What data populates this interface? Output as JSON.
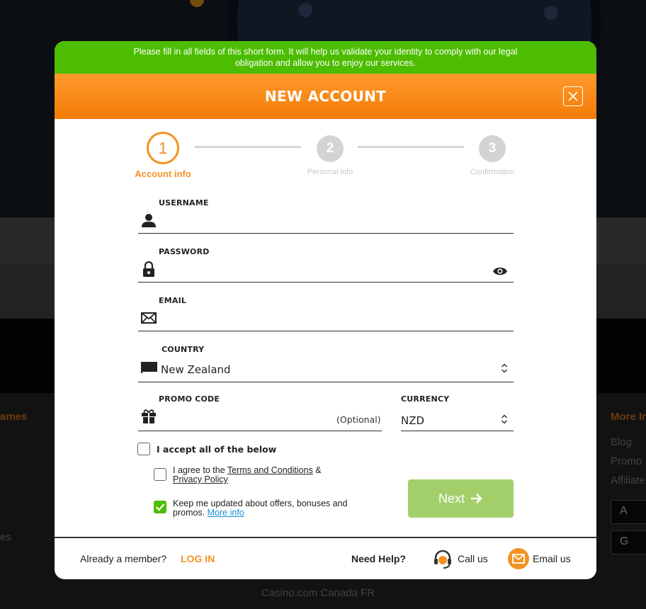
{
  "background": {
    "footer_left": "ames",
    "footer_left2": "es",
    "footer_right_heading": "More In",
    "footer_right_links": [
      "Blog",
      "Promo",
      "Affiliate"
    ],
    "footer_bottom": "Casino.com Canada FR",
    "store_buttons": [
      "A",
      "G"
    ]
  },
  "notice": {
    "text": "Please fill in all fields of this short form. It will help us validate your identity to comply with our legal obligation and allow you to enjoy our services."
  },
  "header": {
    "title": "NEW ACCOUNT"
  },
  "stepper": {
    "steps": [
      {
        "number": "1",
        "label": "Account info"
      },
      {
        "number": "2",
        "label": "Personal info"
      },
      {
        "number": "3",
        "label": "Confirmation"
      }
    ]
  },
  "form": {
    "username": {
      "label": "USERNAME",
      "value": ""
    },
    "password": {
      "label": "PASSWORD",
      "value": ""
    },
    "email": {
      "label": "EMAIL",
      "value": ""
    },
    "country": {
      "label": "COUNTRY",
      "value": "New Zealand"
    },
    "promo": {
      "label": "PROMO CODE",
      "hint": "(Optional)",
      "value": ""
    },
    "currency": {
      "label": "CURRENCY",
      "value": "NZD"
    }
  },
  "consent": {
    "accept_all": "I accept all of the below",
    "terms_prefix": "I agree to the ",
    "terms_link": "Terms and Conditions",
    "terms_amp": " &",
    "privacy_link": "Privacy Policy",
    "updates_text": "Keep me updated about offers, bonuses and promos.",
    "more_info": "More info",
    "accept_all_checked": false,
    "terms_checked": false,
    "updates_checked": true
  },
  "actions": {
    "next_label": "Next"
  },
  "footer": {
    "member_text": "Already a member?",
    "login_label": "LOG IN",
    "help_text": "Need Help?",
    "call_label": "Call us",
    "email_label": "Email us"
  },
  "colors": {
    "notice_green": "#4cbd00",
    "header_orange": "#f47c07",
    "accent_orange": "#f39323",
    "next_button": "#a3cf6b",
    "link_blue": "#1a8fd6"
  },
  "icons": [
    "close-icon",
    "user-icon",
    "lock-icon",
    "eye-icon",
    "envelope-icon",
    "flag-icon",
    "chevron-updown-icon",
    "gift-icon",
    "check-icon",
    "arrow-right-icon",
    "headset-icon",
    "mail-icon"
  ]
}
